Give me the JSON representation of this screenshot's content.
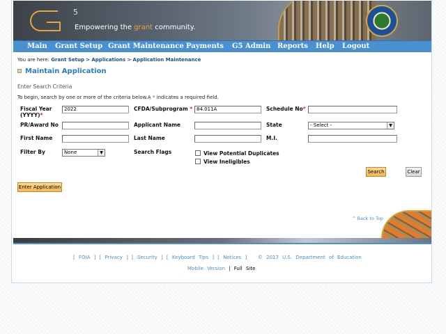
{
  "header": {
    "logo": "G5",
    "tagline_pre": "Empowering the ",
    "tagline_accent": "grant",
    "tagline_post": " community.",
    "seal": "Department of Education, United States of America"
  },
  "nav": [
    "Main",
    "Grant Setup",
    "Grant Maintenance",
    "Payments",
    "G5 Admin",
    "Reports",
    "Help",
    "Logout"
  ],
  "breadcrumb": {
    "prefix": "You are here:",
    "items": [
      "Grant Setup",
      ">",
      "Applications",
      ">",
      "Application Maintenance"
    ]
  },
  "page_title": "Maintain Application",
  "section_title": "Enter Search Criteria",
  "intro": {
    "pre": "To begin, search by one or more of the criteria below.A ",
    "star": "*",
    "post": " indicates a required field."
  },
  "form": {
    "fiscal_year": {
      "label": "Fiscal Year (YYYY)",
      "value": "2022"
    },
    "cfda": {
      "label": "CFDA/Subprogram ",
      "value": "84.011A"
    },
    "schedule": {
      "label": "Schedule No",
      "value": ""
    },
    "pr_award": {
      "label": "PR/Award No",
      "value": ""
    },
    "applicant": {
      "label": "Applicant Name",
      "value": ""
    },
    "state": {
      "label": "State",
      "value": "- Select -"
    },
    "first_name": {
      "label": "First Name",
      "value": ""
    },
    "last_name": {
      "label": "Last Name",
      "value": ""
    },
    "mi": {
      "label": "M.I.",
      "value": ""
    },
    "filter_by": {
      "label": "Filter By",
      "value": "None"
    },
    "search_flags": {
      "label": "Search Flags",
      "options": [
        {
          "label": "View Potential Duplicates",
          "checked": false
        },
        {
          "label": "View Ineligibles",
          "checked": false
        }
      ]
    },
    "required_star": "*"
  },
  "buttons": {
    "search": "Search",
    "clear": "Clear",
    "enter_application": "Enter Application"
  },
  "back_to_top": "^ Back to Top",
  "footer": {
    "links": [
      "FOIA",
      "Privacy",
      "Security",
      "Keyboard Tips",
      "Notices"
    ],
    "copyright": "© 2017 U.S. Department of Education",
    "mobile": "Mobile Version",
    "sep": "|",
    "full": "Full Site"
  },
  "colors": {
    "nav": "#4a8fd0",
    "title": "#2a7ac8",
    "button": "#f5b855",
    "required": "#e02020"
  }
}
